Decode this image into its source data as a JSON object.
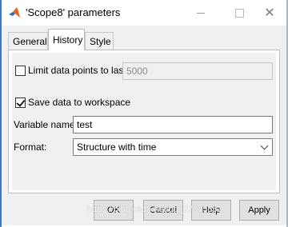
{
  "window": {
    "title": "'Scope8' parameters",
    "close_glyph": "✕"
  },
  "tabs": [
    {
      "label": "General"
    },
    {
      "label": "History"
    },
    {
      "label": "Style"
    }
  ],
  "active_tab": "History",
  "history": {
    "limit_label": "Limit data points to last:",
    "limit_checked": false,
    "limit_value": "5000",
    "save_label": "Save data to workspace",
    "save_checked": true,
    "varname_label": "Variable name:",
    "varname_value": "test",
    "format_label": "Format:",
    "format_value": "Structure with time"
  },
  "buttons": {
    "ok": "OK",
    "cancel": "Cancel",
    "help": "Help",
    "apply": "Apply"
  },
  "watermark": "https://blog.csdn.net/qq_27045351",
  "colors": {
    "dialog_bg": "#f0f0f0",
    "window_edge": "#3a78c8",
    "button_bg": "#e1e1e1"
  }
}
